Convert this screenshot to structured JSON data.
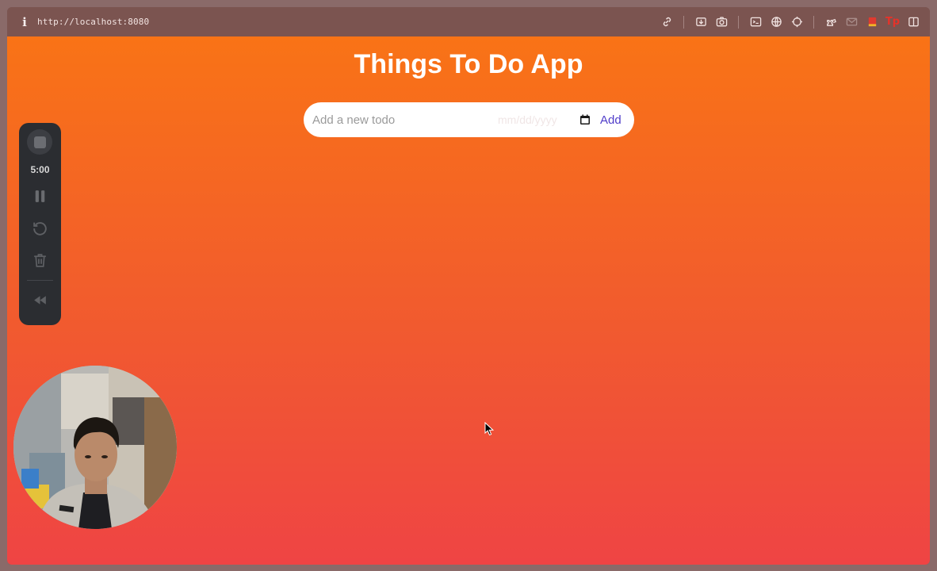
{
  "browser": {
    "url": "http://localhost:8080",
    "info_icon": "info-icon",
    "toolbar_icons": [
      "link-icon",
      "download-icon",
      "camera-icon",
      "terminal-icon",
      "globe-icon",
      "crosshair-icon",
      "extensions-icon",
      "mail-icon",
      "bookmark-icon",
      "tp-extension-icon",
      "sidebar-toggle-icon"
    ],
    "tp_extension_label": "Tp"
  },
  "app": {
    "title": "Things To Do App",
    "todo_input": {
      "placeholder": "Add a new todo",
      "value": ""
    },
    "date_input": {
      "placeholder": "mm/dd/yyyy"
    },
    "add_button_label": "Add",
    "accent_color": "#4f3cc9",
    "gradient_top": "#f97316",
    "gradient_bottom": "#ef4444"
  },
  "recorder": {
    "time": "5:00",
    "controls": [
      "stop-icon",
      "pause-icon",
      "restart-icon",
      "trash-icon",
      "rewind-icon"
    ]
  },
  "webcam": {
    "icon": "webcam-bubble"
  }
}
